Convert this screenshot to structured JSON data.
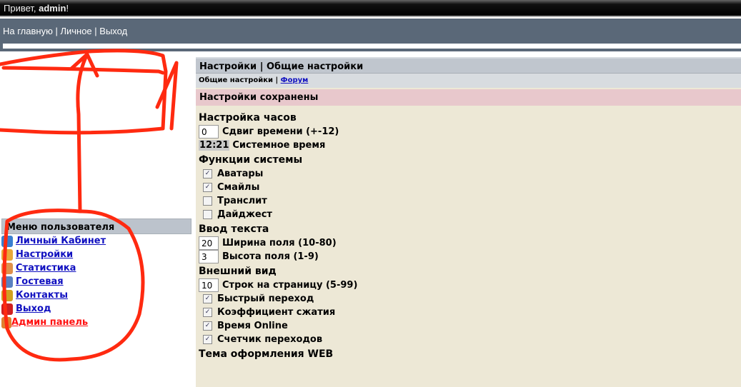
{
  "header": {
    "greeting": "Привет, ",
    "user": "admin",
    "excl": "!"
  },
  "nav": {
    "home": "На главную",
    "sep1": " | ",
    "personal": "Личное",
    "sep2": " | ",
    "logout": "Выход"
  },
  "sidebar": {
    "title": "Меню пользователя",
    "items": [
      {
        "label": "Личный Кабинет",
        "icon": "profile-card-icon",
        "color": "#3a7fd0"
      },
      {
        "label": "Настройки",
        "icon": "gear-icon",
        "color": "#e8a838"
      },
      {
        "label": "Статистика",
        "icon": "user-edit-icon",
        "color": "#e0904a"
      },
      {
        "label": "Гостевая",
        "icon": "notepad-pencil-icon",
        "color": "#5a80c0"
      },
      {
        "label": "Контакты",
        "icon": "contacts-icon",
        "color": "#d0a020"
      },
      {
        "label": "Выход",
        "icon": "stop-icon",
        "color": "#d02020"
      },
      {
        "label": "Админ панель",
        "icon": "admin-folder-icon",
        "color": "#e08030"
      }
    ]
  },
  "main": {
    "title": "Настройки | Общие настройки",
    "sub_current": "Общие настройки",
    "sub_sep": " | ",
    "sub_link": "Форум",
    "saved": "Настройки сохранены",
    "clock": {
      "heading": "Настройка часов",
      "offset_value": "0",
      "offset_label": "Сдвиг времени (+-12)",
      "time": "12:21",
      "time_label": "Системное время"
    },
    "functions": {
      "heading": "Функции системы",
      "items": [
        {
          "label": "Аватары",
          "checked": true
        },
        {
          "label": "Смайлы",
          "checked": true
        },
        {
          "label": "Транслит",
          "checked": false
        },
        {
          "label": "Дайджест",
          "checked": false
        }
      ]
    },
    "text_input": {
      "heading": "Ввод текста",
      "width_value": "20",
      "width_label": "Ширина поля (10-80)",
      "height_value": "3",
      "height_label": "Высота поля (1-9)"
    },
    "appearance": {
      "heading": "Внешний вид",
      "rows_value": "10",
      "rows_label": "Строк на страницу (5-99)",
      "items": [
        {
          "label": "Быстрый переход",
          "checked": true
        },
        {
          "label": "Коэффициент сжатия",
          "checked": true
        },
        {
          "label": "Время Online",
          "checked": true
        },
        {
          "label": "Счетчик переходов",
          "checked": true
        }
      ]
    },
    "theme": {
      "heading": "Тема оформления WEB"
    }
  },
  "annotation_color": "#ff2a10"
}
